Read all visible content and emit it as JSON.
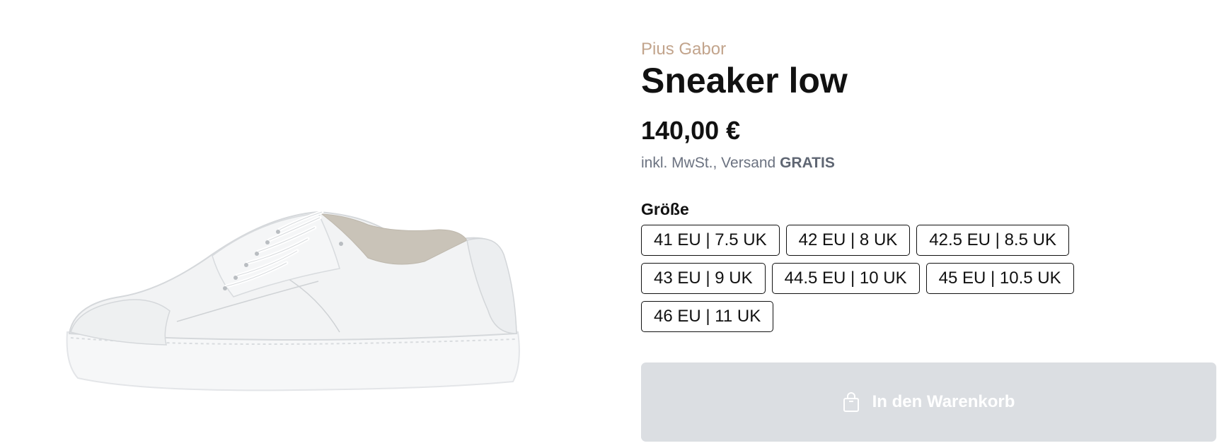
{
  "product": {
    "brand": "Pius Gabor",
    "title": "Sneaker low",
    "price": "140,00 €",
    "tax_prefix": "inkl. MwSt., Versand ",
    "shipping_badge": "GRATIS",
    "image_alt": "white leather sneaker",
    "image_icon": "sneaker-image"
  },
  "size_selector": {
    "label": "Größe",
    "rows": [
      [
        "41 EU | 7.5 UK",
        "42 EU | 8 UK",
        "42.5 EU | 8.5 UK"
      ],
      [
        "43 EU | 9 UK",
        "44.5 EU | 10 UK",
        "45 EU | 10.5 UK"
      ],
      [
        "46 EU | 11 UK"
      ]
    ]
  },
  "cart": {
    "label": "In den Warenkorb",
    "icon": "shopping-bag-icon",
    "disabled": true
  },
  "colors": {
    "brand": "#c2a48c",
    "button_disabled_bg": "#dbdee2",
    "muted_text": "#6b7280"
  }
}
